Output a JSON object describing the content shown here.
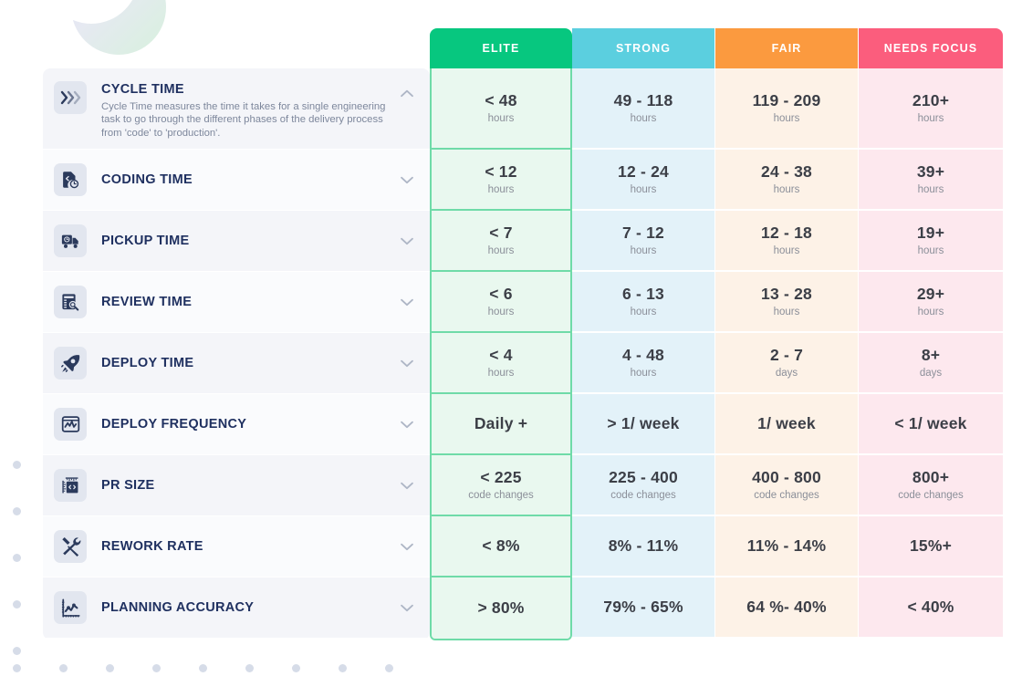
{
  "columns": [
    {
      "key": "elite",
      "label": "ELITE",
      "color": "#07c77f",
      "cell_bg": "#e9f8ef"
    },
    {
      "key": "strong",
      "label": "STRONG",
      "color": "#5bcfdf",
      "cell_bg": "#e3f2f9"
    },
    {
      "key": "fair",
      "label": "FAIR",
      "color": "#fb9a3f",
      "cell_bg": "#fdf2e7"
    },
    {
      "key": "needs",
      "label": "NEEDS FOCUS",
      "color": "#fb5d7d",
      "cell_bg": "#fde8ee"
    }
  ],
  "rows": [
    {
      "title": "CYCLE TIME",
      "description": "Cycle Time measures the time it takes for a single engineering task to go through the different phases of the delivery process from 'code' to 'production'.",
      "icon": "chevrons-right-icon",
      "expanded": true,
      "chevron": "chevron-up-icon",
      "cells": [
        {
          "value": "< 48",
          "unit": "hours"
        },
        {
          "value": "49 - 118",
          "unit": "hours"
        },
        {
          "value": "119 - 209",
          "unit": "hours"
        },
        {
          "value": "210+",
          "unit": "hours"
        }
      ]
    },
    {
      "title": "CODING TIME",
      "description": "",
      "icon": "file-clock-icon",
      "expanded": false,
      "chevron": "chevron-down-icon",
      "cells": [
        {
          "value": "< 12",
          "unit": "hours"
        },
        {
          "value": "12 - 24",
          "unit": "hours"
        },
        {
          "value": "24 - 38",
          "unit": "hours"
        },
        {
          "value": "39+",
          "unit": "hours"
        }
      ]
    },
    {
      "title": "PICKUP TIME",
      "description": "",
      "icon": "delivery-truck-clock-icon",
      "expanded": false,
      "chevron": "chevron-down-icon",
      "cells": [
        {
          "value": "< 7",
          "unit": "hours"
        },
        {
          "value": "7 - 12",
          "unit": "hours"
        },
        {
          "value": "12 - 18",
          "unit": "hours"
        },
        {
          "value": "19+",
          "unit": "hours"
        }
      ]
    },
    {
      "title": "REVIEW TIME",
      "description": "",
      "icon": "document-search-icon",
      "expanded": false,
      "chevron": "chevron-down-icon",
      "cells": [
        {
          "value": "< 6",
          "unit": "hours"
        },
        {
          "value": "6 - 13",
          "unit": "hours"
        },
        {
          "value": "13 - 28",
          "unit": "hours"
        },
        {
          "value": "29+",
          "unit": "hours"
        }
      ]
    },
    {
      "title": "DEPLOY TIME",
      "description": "",
      "icon": "rocket-icon",
      "expanded": false,
      "chevron": "chevron-down-icon",
      "cells": [
        {
          "value": "< 4",
          "unit": "hours"
        },
        {
          "value": "4 - 48",
          "unit": "hours"
        },
        {
          "value": "2 - 7",
          "unit": "days"
        },
        {
          "value": "8+",
          "unit": "days"
        }
      ]
    },
    {
      "title": "DEPLOY FREQUENCY",
      "description": "",
      "icon": "activity-monitor-icon",
      "expanded": false,
      "chevron": "chevron-down-icon",
      "cells": [
        {
          "value": "Daily +",
          "unit": ""
        },
        {
          "value": "> 1/ week",
          "unit": ""
        },
        {
          "value": "1/ week",
          "unit": ""
        },
        {
          "value": "< 1/ week",
          "unit": ""
        }
      ]
    },
    {
      "title": "PR SIZE",
      "description": "",
      "icon": "code-ruler-icon",
      "expanded": false,
      "chevron": "chevron-down-icon",
      "cells": [
        {
          "value": "< 225",
          "unit": "code changes"
        },
        {
          "value": "225 - 400",
          "unit": "code changes"
        },
        {
          "value": "400 - 800",
          "unit": "code changes"
        },
        {
          "value": "800+",
          "unit": "code changes"
        }
      ]
    },
    {
      "title": "REWORK RATE",
      "description": "",
      "icon": "tools-icon",
      "expanded": false,
      "chevron": "chevron-down-icon",
      "cells": [
        {
          "value": "< 8%",
          "unit": ""
        },
        {
          "value": "8% - 11%",
          "unit": ""
        },
        {
          "value": "11% - 14%",
          "unit": ""
        },
        {
          "value": "15%+",
          "unit": ""
        }
      ]
    },
    {
      "title": "PLANNING ACCURACY",
      "description": "",
      "icon": "line-chart-icon",
      "expanded": false,
      "chevron": "chevron-down-icon",
      "cells": [
        {
          "value": "> 80%",
          "unit": ""
        },
        {
          "value": "79% - 65%",
          "unit": ""
        },
        {
          "value": "64 %- 40%",
          "unit": ""
        },
        {
          "value": "< 40%",
          "unit": ""
        }
      ]
    }
  ],
  "decor": {
    "blob": "gradient-crescent-blob",
    "left_dots_count": 5,
    "bottom_dots_count": 9
  }
}
